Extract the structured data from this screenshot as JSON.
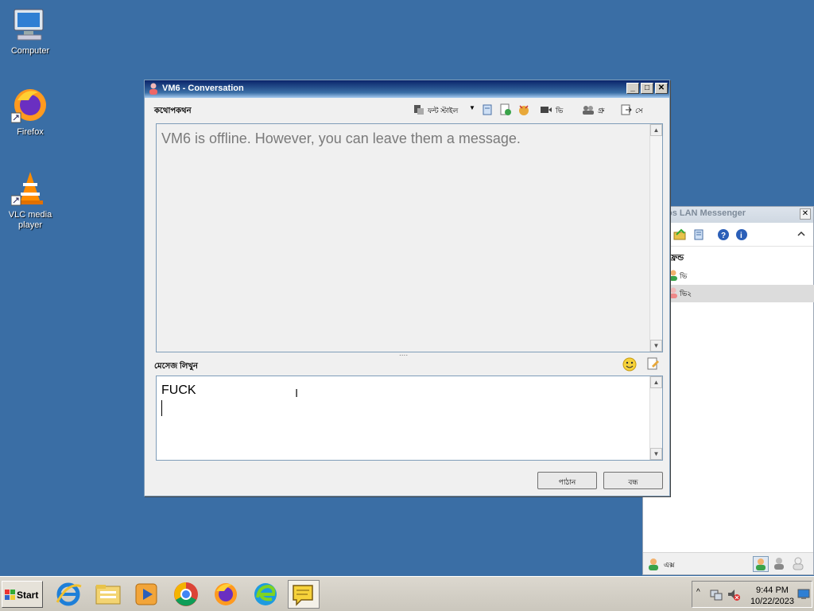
{
  "desktop": {
    "icons": [
      {
        "label": "Computer"
      },
      {
        "label": "Firefox"
      },
      {
        "label": "VLC media\nplayer"
      }
    ]
  },
  "messenger": {
    "title": "os LAN Messenger",
    "close_glyph": "✕",
    "group_label": "ফ্রেন্ড",
    "users": [
      {
        "name": "ভি",
        "status": "online"
      },
      {
        "name": "ভি২",
        "status": "offline"
      }
    ],
    "status_label": "এক্স"
  },
  "conversation": {
    "title": "VM6 - Conversation",
    "header_label": "কথোপকথন",
    "toolbar": {
      "font_label": "ফন্ট স্টাইল",
      "video_label": "ভি",
      "group_label": "গ্রু",
      "save_label": "সে"
    },
    "history_text": "VM6 is offline. However, you can leave them a message.",
    "splitter_glyph": "....",
    "compose_label": "মেসেজ লিখুন",
    "input_text": "FUCK",
    "send_button": "পাঠান",
    "close_button": "বন্ধ"
  },
  "taskbar": {
    "start_label": "Start",
    "time": "9:44 PM",
    "date": "10/22/2023"
  },
  "colors": {
    "desktop": "#3a6ea5",
    "titlebar_active": "#0a246a",
    "selection": "#dcdcdc"
  }
}
